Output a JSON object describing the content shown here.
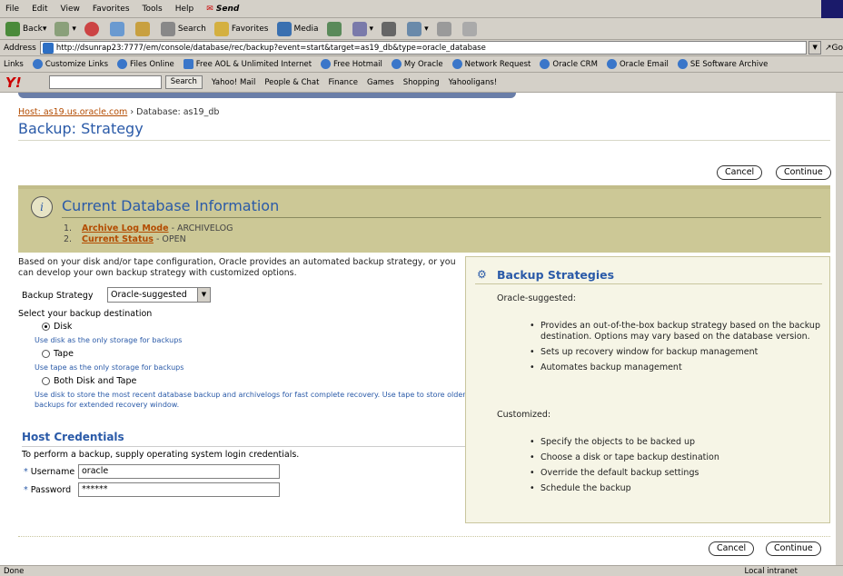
{
  "browser": {
    "menu": [
      "File",
      "Edit",
      "View",
      "Favorites",
      "Tools",
      "Help"
    ],
    "send_label": "Send",
    "toolbar": {
      "back": "Back",
      "search": "Search",
      "favorites": "Favorites",
      "media": "Media"
    },
    "address_label": "Address",
    "url": "http://dsunrap23:7777/em/console/database/rec/backup?event=start&target=as19_db&type=oracle_database",
    "go_label": "Go",
    "links_label": "Links",
    "links": [
      "Customize Links",
      "Files Online",
      "Free AOL & Unlimited Internet",
      "Free Hotmail",
      "My Oracle",
      "Network Request",
      "Oracle CRM",
      "Oracle Email",
      "SE Software Archive"
    ],
    "yahoo": {
      "search_button": "Search",
      "items": [
        "Yahoo! Mail",
        "People & Chat",
        "Finance",
        "Games",
        "Shopping",
        "Yahooligans!"
      ]
    },
    "status_text": "Done",
    "zone_text": "Local intranet"
  },
  "breadcrumb": {
    "host_link": "Host: as19.us.oracle.com",
    "separator": "›",
    "current": "Database: as19_db"
  },
  "page_title": "Backup: Strategy",
  "buttons": {
    "cancel": "Cancel",
    "continue": "Continue"
  },
  "info": {
    "title": "Current Database Information",
    "items": [
      {
        "num": "1.",
        "link": "Archive Log Mode",
        "value": " - ARCHIVELOG"
      },
      {
        "num": "2.",
        "link": "Current Status",
        "value": " - OPEN"
      }
    ]
  },
  "intro": "Based on your disk and/or tape configuration, Oracle provides an automated backup strategy, or you can develop your own backup strategy with customized options.",
  "strategy": {
    "label": "Backup Strategy",
    "selected": "Oracle-suggested"
  },
  "destination": {
    "label": "Select your backup destination",
    "options": [
      {
        "label": "Disk",
        "hint": "Use disk as the only storage for backups",
        "checked": true
      },
      {
        "label": "Tape",
        "hint": "Use tape as the only storage for backups",
        "checked": false
      },
      {
        "label": "Both Disk and Tape",
        "hint": "Use disk to store the most recent database backup and archivelogs for fast complete recovery. Use tape to store older backups for extended recovery window.",
        "checked": false
      }
    ]
  },
  "credentials": {
    "title": "Host Credentials",
    "intro": "To perform a backup, supply operating system login credentials.",
    "required_mark": "*",
    "username_label": "Username",
    "username_value": "oracle",
    "password_label": "Password",
    "password_value": "******"
  },
  "side": {
    "title": "Backup Strategies",
    "oracle_head": "Oracle-suggested:",
    "oracle_items": [
      "Provides an out-of-the-box backup strategy based on the backup destination. Options may vary based on the database version.",
      "Sets up recovery window for backup management",
      "Automates backup management"
    ],
    "custom_head": "Customized:",
    "custom_items": [
      "Specify the objects to be backed up",
      "Choose a disk or tape backup destination",
      "Override the default backup settings",
      "Schedule the backup"
    ]
  }
}
